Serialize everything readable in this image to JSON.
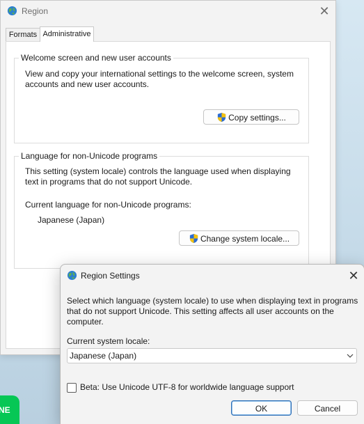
{
  "region_window": {
    "title": "Region",
    "tabs": [
      {
        "label": "Formats",
        "selected": false
      },
      {
        "label": "Administrative",
        "selected": true
      }
    ],
    "welcome_group": {
      "legend": "Welcome screen and new user accounts",
      "description_line1": "View and copy your international settings to the welcome screen, system",
      "description_line2": "accounts and new user accounts.",
      "button_label": "Copy settings..."
    },
    "nonunicode_group": {
      "legend": "Language for non-Unicode programs",
      "description_line1": "This setting (system locale) controls the language used when displaying",
      "description_line2": "text in programs that do not support Unicode.",
      "current_label": "Current language for non-Unicode programs:",
      "current_value": "Japanese (Japan)",
      "button_label": "Change system locale..."
    }
  },
  "settings_dialog": {
    "title": "Region Settings",
    "description_line1": "Select which language (system locale) to use when displaying text in programs",
    "description_line2": "that do not support Unicode. This setting affects all user accounts on the",
    "description_line3": "computer.",
    "locale_label": "Current system locale:",
    "locale_value": "Japanese (Japan)",
    "beta_label": "Beta: Use Unicode UTF-8 for worldwide language support",
    "beta_checked": false,
    "ok_label": "OK",
    "cancel_label": "Cancel"
  },
  "taskbar_app": {
    "label": "NE"
  },
  "colors": {
    "window_bg": "#f3f3f3",
    "panel_bg": "#ffffff",
    "accent_border": "#2e6fb6",
    "line_green": "#06c755"
  },
  "icons": [
    "globe-icon",
    "close-icon",
    "uac-shield-icon",
    "chevron-down-icon"
  ]
}
